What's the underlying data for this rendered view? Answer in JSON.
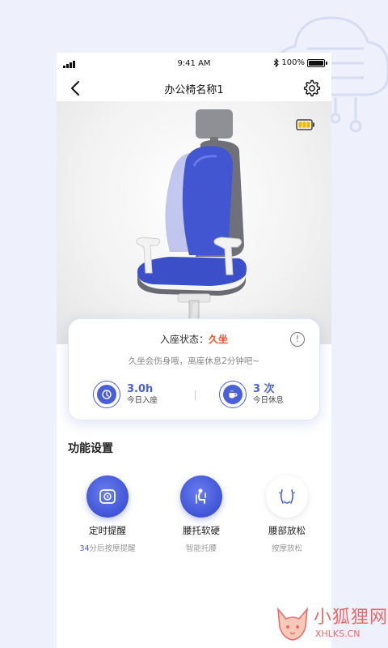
{
  "status_bar": {
    "time": "9:41 AM",
    "battery": "100%"
  },
  "header": {
    "title": "办公椅名称1"
  },
  "seat_status": {
    "label": "入座状态：",
    "value": "久坐",
    "tip": "久坐会伤身哦，离座休息2分钟吧~"
  },
  "stats": [
    {
      "value": "3.0h",
      "label": "今日入座"
    },
    {
      "value": "3 次",
      "label": "今日休息"
    }
  ],
  "section": {
    "title": "功能设置"
  },
  "functions": [
    {
      "label": "定时提醒",
      "sub_highlight": "34",
      "sub_rest": "分后按摩提醒"
    },
    {
      "label": "腰托软硬",
      "sub": "智能托腰"
    },
    {
      "label": "腰部放松",
      "sub": "按摩放松"
    }
  ],
  "watermark": {
    "name": "小狐狸网",
    "url": "XHLKS.CN"
  },
  "colors": {
    "accent": "#4a5fd8",
    "warning": "#e5552f",
    "background": "#eef1fb"
  },
  "icons": [
    "back-arrow-icon",
    "gear-icon",
    "device-battery-icon",
    "info-icon",
    "clock-icon",
    "cup-icon",
    "timer-icon",
    "lumbar-icon",
    "relax-icon",
    "fox-icon"
  ]
}
